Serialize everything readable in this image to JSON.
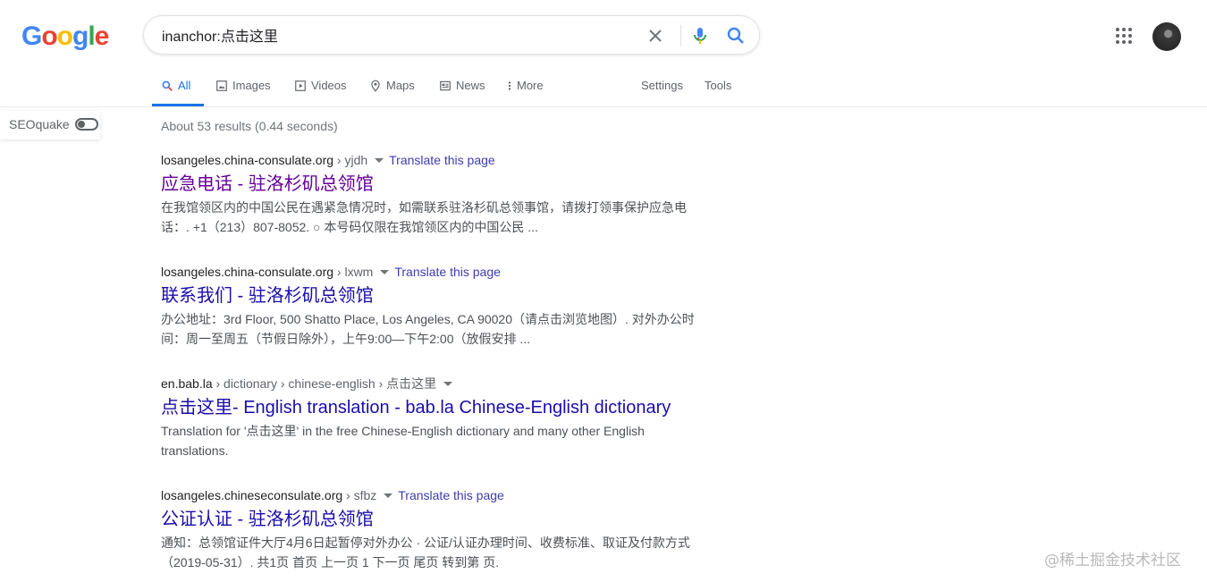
{
  "logo": {
    "letters": [
      "G",
      "o",
      "o",
      "g",
      "l",
      "e"
    ],
    "colors": [
      "#4285f4",
      "#ea4335",
      "#fbbc05",
      "#4285f4",
      "#34a853",
      "#ea4335"
    ]
  },
  "search": {
    "value": "inanchor:点击这里"
  },
  "tabs": [
    {
      "label": "All",
      "icon": "search-icon"
    },
    {
      "label": "Images",
      "icon": "image-icon"
    },
    {
      "label": "Videos",
      "icon": "play-icon"
    },
    {
      "label": "Maps",
      "icon": "pin-icon"
    },
    {
      "label": "News",
      "icon": "news-icon"
    },
    {
      "label": "More",
      "icon": "more-vertical-icon"
    },
    {
      "label": "Settings"
    },
    {
      "label": "Tools"
    }
  ],
  "seoquake": {
    "label": "SEOquake"
  },
  "stats": "About 53 results (0.44 seconds)",
  "results": [
    {
      "domain": "losangeles.china-consulate.org",
      "crumbs": " › yjdh",
      "translate": "Translate this page",
      "title": "应急电话 - 驻洛杉矶总领馆",
      "snippet": "在我馆领区内的中国公民在遇紧急情况时，如需联系驻洛杉矶总领事馆，请拨打领事保护应急电话：. +1（213）807-8052. ○ 本号码仅限在我馆领区内的中国公民 ..."
    },
    {
      "domain": "losangeles.china-consulate.org",
      "crumbs": " › lxwm",
      "translate": "Translate this page",
      "title": "联系我们 - 驻洛杉矶总领馆",
      "snippet": "办公地址：3rd Floor, 500 Shatto Place, Los Angeles, CA 90020（请点击浏览地图）. 对外办公时间：周一至周五（节假日除外），上午9:00—下午2:00（放假安排 ..."
    },
    {
      "domain": "en.bab.la",
      "crumbs": " › dictionary › chinese-english › 点击这里",
      "translate": "",
      "title": "点击这里- English translation - bab.la Chinese-English dictionary",
      "snippet": "Translation for '点击这里' in the free Chinese-English dictionary and many other English translations."
    },
    {
      "domain": "losangeles.chineseconsulate.org",
      "crumbs": " › sfbz",
      "translate": "Translate this page",
      "title": "公证认证 - 驻洛杉矶总领馆",
      "snippet": "通知：总领馆证件大厅4月6日起暂停对外办公 · 公证/认证办理时间、收费标准、取证及付款方式（2019-05-31）. 共1页 首页 上一页 1 下一页 尾页 转到第 页."
    }
  ],
  "watermark": "@稀土掘金技术社区"
}
